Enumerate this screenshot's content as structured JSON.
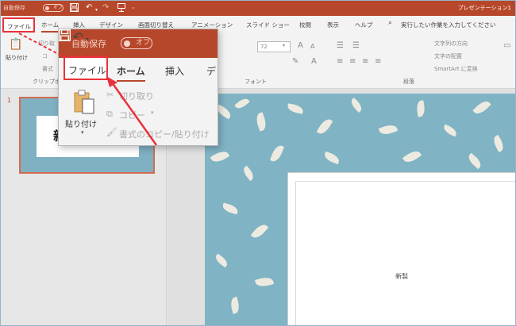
{
  "titlebar": {
    "autosave_label": "自動保存",
    "toggle_label": "オフ",
    "doc_title": "プレゼンテーション1",
    "save_icon": "save-icon",
    "undo_icon": "undo-icon",
    "redo_icon": "redo-icon",
    "present_icon": "present-from-start-icon",
    "customize_icon": "customize-quick-access-icon"
  },
  "tabs": [
    "ファイル",
    "ホーム",
    "挿入",
    "デザイン",
    "画面切り替え",
    "アニメーション",
    "スライド ショー",
    "校閲",
    "表示",
    "ヘルプ",
    "実行したい作業を入力してください"
  ],
  "ribbon": {
    "paste_label": "貼り付け",
    "clipboard_group": "クリップボ",
    "font_group": "フォント",
    "paragraph_group": "段落",
    "font_size": "72",
    "text_direction": "文字列の方向",
    "text_align": "文字の配置",
    "smartart": "SmartArt に変換",
    "cut_short": "切り取",
    "copy_short": "コ",
    "format_short": "書式"
  },
  "slides_panel": {
    "slide_number": "1",
    "thumb_title": "新"
  },
  "slide": {
    "title": "新製"
  },
  "popup": {
    "autosave_label": "自動保存",
    "toggle_label": "オフ",
    "file_tab": "ファイル",
    "home_tab": "ホーム",
    "insert_tab": "挿入",
    "design_tab": "デ",
    "paste_label": "貼り付け",
    "cut_label": "切り取り",
    "copy_label": "コピー",
    "format_painter_label": "書式のコピー/貼り付け"
  },
  "colors": {
    "accent": "#b7472a",
    "highlight": "#e8323b",
    "slide_bg": "#80b3c4",
    "leaf": "#f2eee3"
  }
}
